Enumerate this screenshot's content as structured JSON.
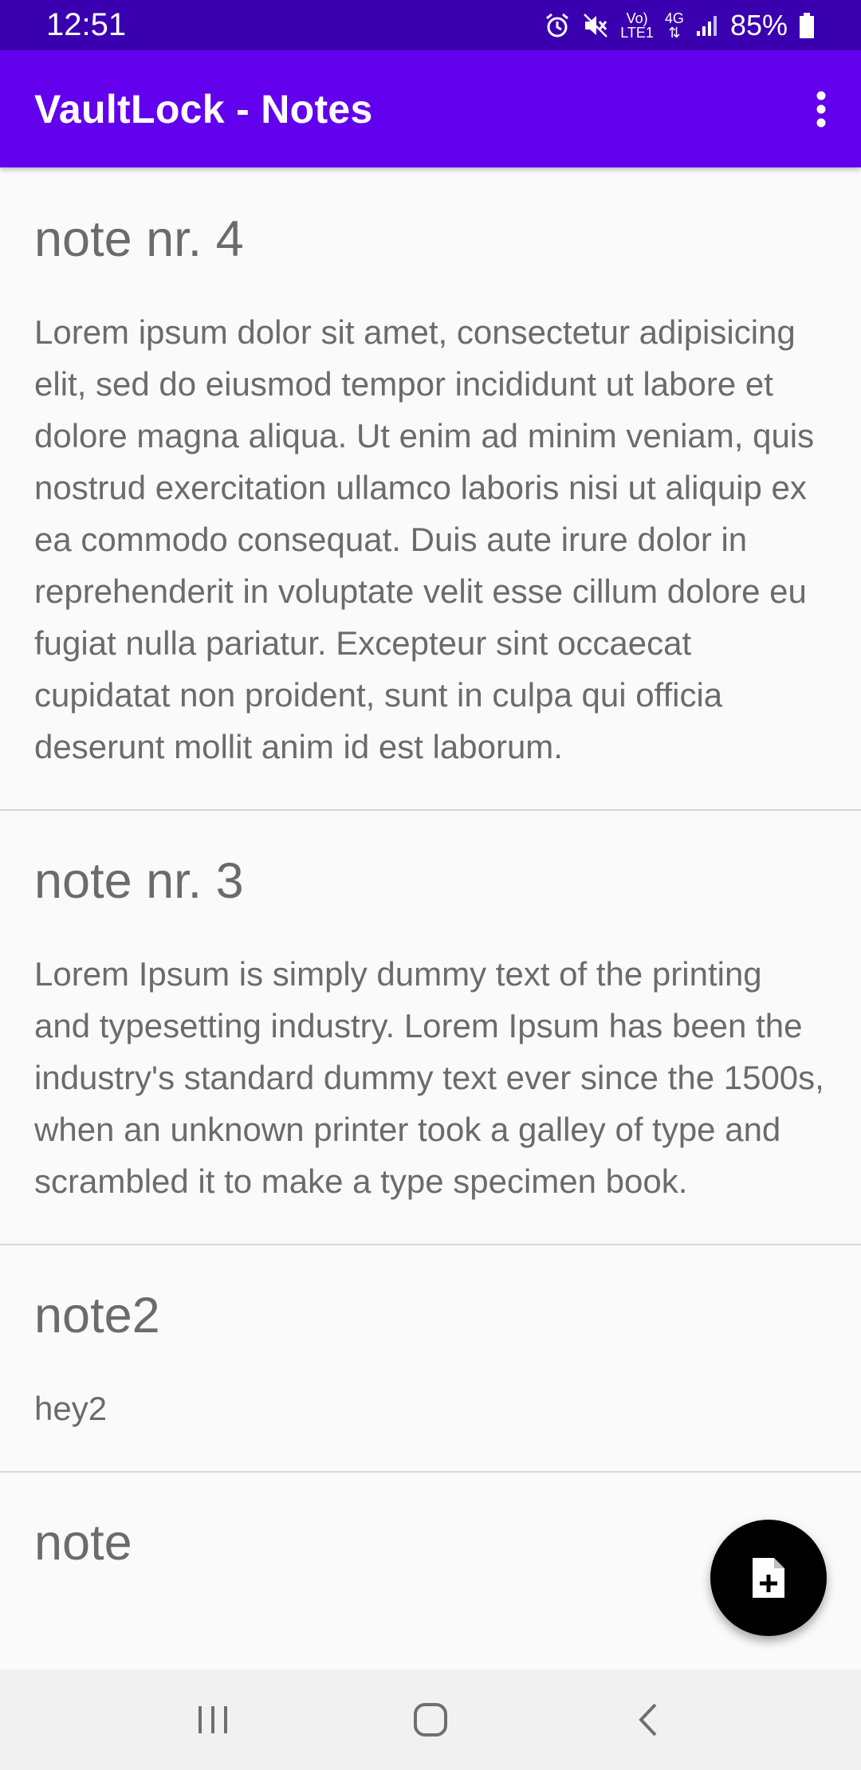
{
  "status_bar": {
    "time": "12:51",
    "lte_label": "LTE1",
    "volte_label": "Vo)",
    "network_label": "4G",
    "battery": "85%",
    "icons": [
      "alarm-icon",
      "mute-icon",
      "volte-icon",
      "4g-icon",
      "signal-icon",
      "battery-icon"
    ]
  },
  "app_bar": {
    "title": "VaultLock - Notes",
    "menu_icon": "more-vert-icon"
  },
  "notes": [
    {
      "title": "note nr. 4",
      "body": "Lorem ipsum dolor sit amet, consectetur adipisicing elit, sed do eiusmod tempor incididunt ut labore et dolore magna aliqua. Ut enim ad minim veniam, quis nostrud exercitation ullamco laboris nisi ut aliquip ex ea commodo consequat. Duis aute irure dolor in reprehenderit in voluptate velit esse cillum dolore eu fugiat nulla pariatur. Excepteur sint occaecat cupidatat non proident, sunt in culpa qui officia deserunt mollit anim id est laborum."
    },
    {
      "title": "note nr. 3",
      "body": "Lorem Ipsum is simply dummy text of the printing and typesetting industry. Lorem Ipsum has been the industry's standard dummy text ever since the 1500s, when an unknown printer took a galley of type and scrambled it to make a type specimen book."
    },
    {
      "title": "note2",
      "body": "hey2"
    },
    {
      "title": "note",
      "body": ""
    }
  ],
  "fab": {
    "icon": "add-note-icon"
  },
  "nav_bar": {
    "icons": [
      "recents-icon",
      "home-icon",
      "back-icon"
    ]
  },
  "colors": {
    "status_bar": "#3a00b0",
    "app_bar": "#6200ee",
    "fab": "#000000",
    "text": "#6b6b6b",
    "background": "#fafafa"
  }
}
